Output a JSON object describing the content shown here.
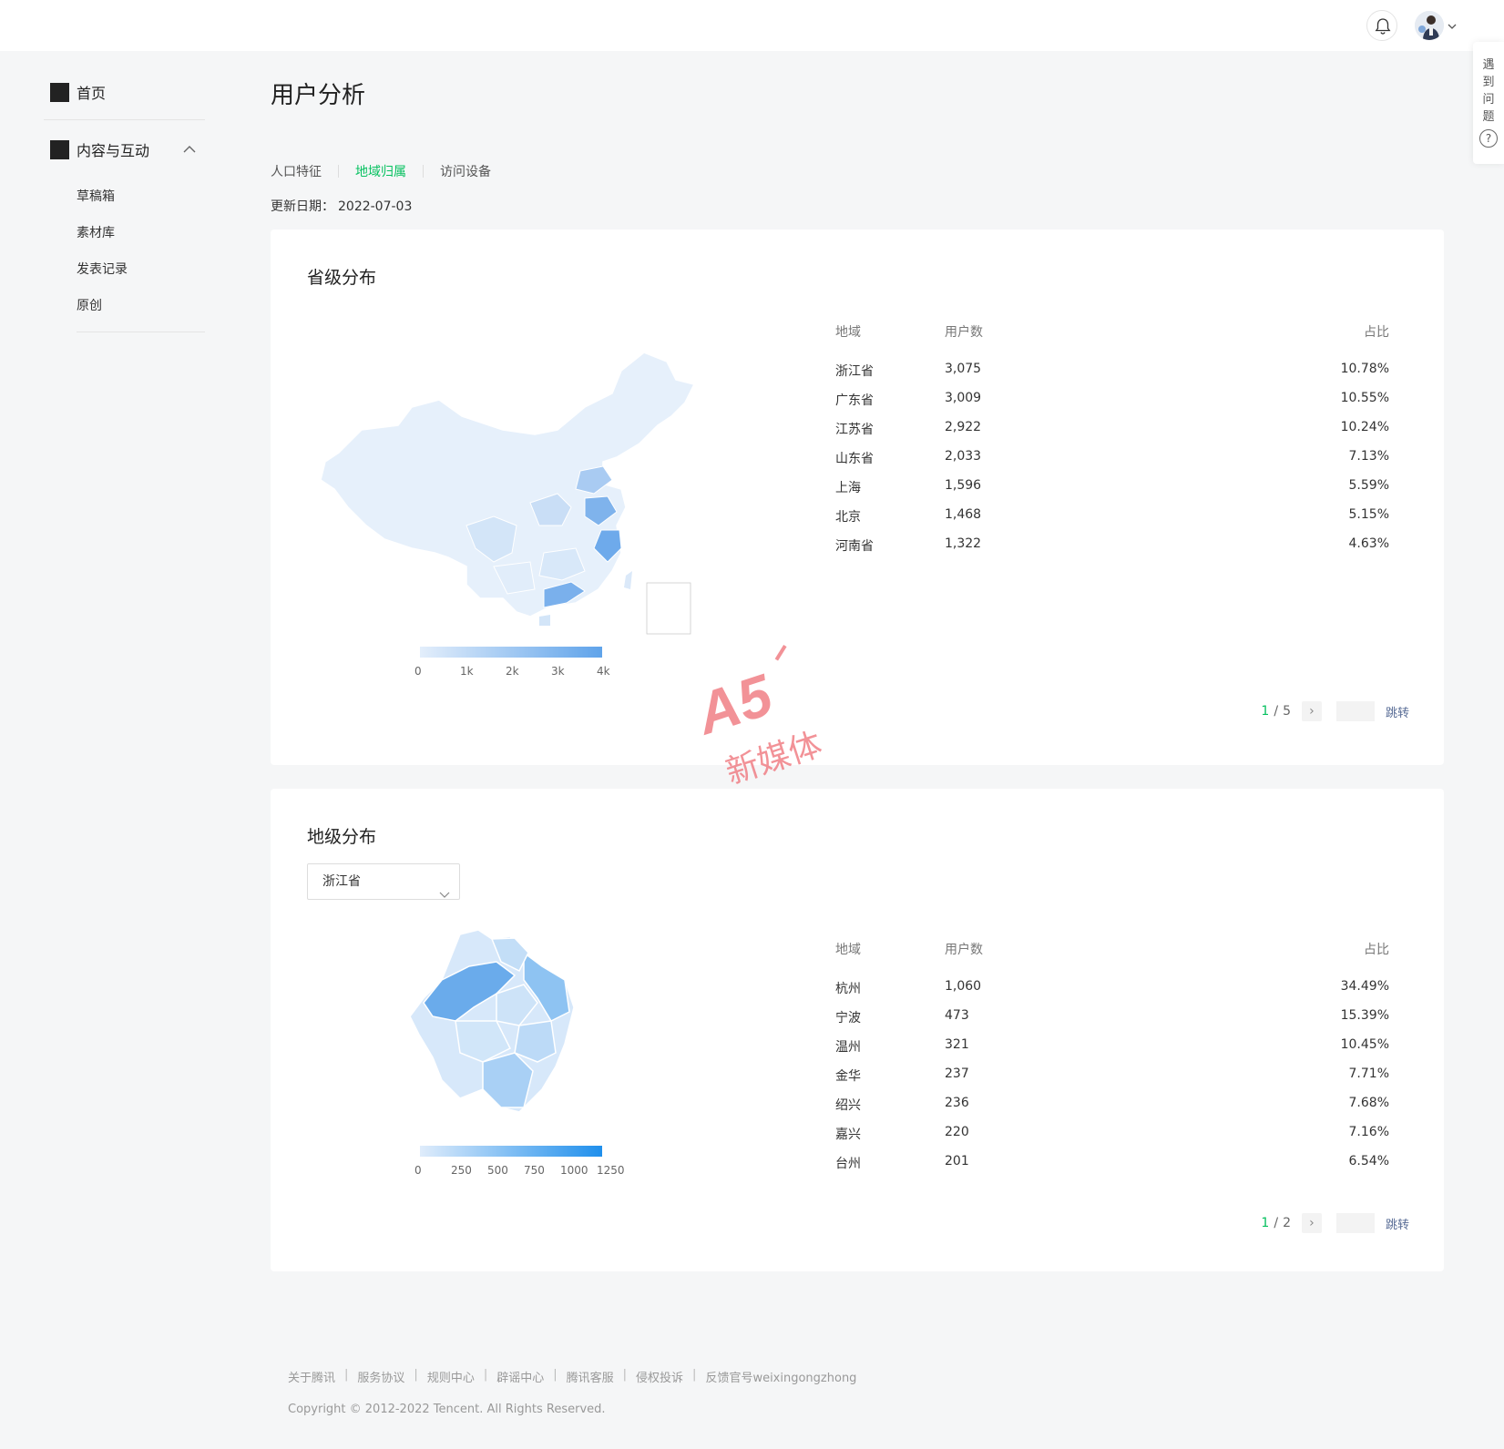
{
  "header": {
    "bell_icon": "bell-icon",
    "avatar": "user-avatar",
    "dropdown_icon": "chevron-down-icon"
  },
  "help": {
    "label": "遇到问题",
    "icon_text": "?"
  },
  "sidebar": {
    "home": "首页",
    "content_group": "内容与互动",
    "sub_items": [
      "草稿箱",
      "素材库",
      "发表记录",
      "原创"
    ]
  },
  "page": {
    "title": "用户分析",
    "tabs": [
      "人口特征",
      "地域归属",
      "访问设备"
    ],
    "active_tab": "地域归属",
    "update_label": "更新日期：",
    "update_date": "2022-07-03"
  },
  "province": {
    "title": "省级分布",
    "columns": [
      "地域",
      "用户数",
      "占比"
    ],
    "rows": [
      {
        "region": "浙江省",
        "users": "3,075",
        "pct": "10.78%"
      },
      {
        "region": "广东省",
        "users": "3,009",
        "pct": "10.55%"
      },
      {
        "region": "江苏省",
        "users": "2,922",
        "pct": "10.24%"
      },
      {
        "region": "山东省",
        "users": "2,033",
        "pct": "7.13%"
      },
      {
        "region": "上海",
        "users": "1,596",
        "pct": "5.59%"
      },
      {
        "region": "北京",
        "users": "1,468",
        "pct": "5.15%"
      },
      {
        "region": "河南省",
        "users": "1,322",
        "pct": "4.63%"
      }
    ],
    "legend": [
      "0",
      "1k",
      "2k",
      "3k",
      "4k"
    ],
    "pager": {
      "current": "1",
      "total": "5",
      "jump": "跳转"
    }
  },
  "city": {
    "title": "地级分布",
    "select_value": "浙江省",
    "columns": [
      "地域",
      "用户数",
      "占比"
    ],
    "rows": [
      {
        "region": "杭州",
        "users": "1,060",
        "pct": "34.49%"
      },
      {
        "region": "宁波",
        "users": "473",
        "pct": "15.39%"
      },
      {
        "region": "温州",
        "users": "321",
        "pct": "10.45%"
      },
      {
        "region": "金华",
        "users": "237",
        "pct": "7.71%"
      },
      {
        "region": "绍兴",
        "users": "236",
        "pct": "7.68%"
      },
      {
        "region": "嘉兴",
        "users": "220",
        "pct": "7.16%"
      },
      {
        "region": "台州",
        "users": "201",
        "pct": "6.54%"
      }
    ],
    "legend": [
      "0",
      "250",
      "500",
      "750",
      "1000",
      "1250"
    ],
    "pager": {
      "current": "1",
      "total": "2",
      "jump": "跳转"
    }
  },
  "footer": {
    "links": [
      "关于腾讯",
      "服务协议",
      "规则中心",
      "辟谣中心",
      "腾讯客服",
      "侵权投诉",
      "反馈官号weixingongzhong"
    ],
    "copyright": "Copyright © 2012-2022 Tencent. All Rights Reserved."
  },
  "watermark": {
    "brand": "A5",
    "text": "新媒体"
  },
  "colors": {
    "accent": "#07c160",
    "link": "#576b95",
    "map_low": "#e6f0fb",
    "map_high": "#4a9be8"
  }
}
